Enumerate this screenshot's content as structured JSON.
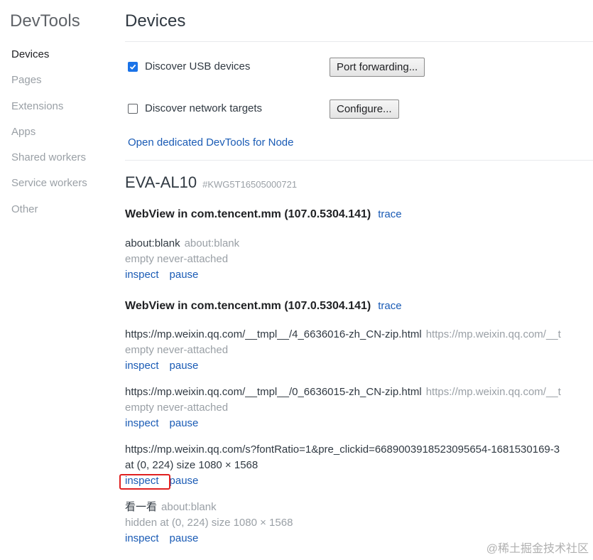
{
  "sidebar": {
    "title": "DevTools",
    "items": [
      {
        "label": "Devices",
        "selected": true
      },
      {
        "label": "Pages"
      },
      {
        "label": "Extensions"
      },
      {
        "label": "Apps"
      },
      {
        "label": "Shared workers"
      },
      {
        "label": "Service workers"
      },
      {
        "label": "Other"
      }
    ]
  },
  "main": {
    "title": "Devices",
    "discover_usb": {
      "label": "Discover USB devices",
      "checked": true,
      "button": "Port forwarding..."
    },
    "discover_network": {
      "label": "Discover network targets",
      "checked": false,
      "button": "Configure..."
    },
    "node_link": "Open dedicated DevTools for Node",
    "device": {
      "model": "EVA-AL10",
      "serial": "#KWG5T16505000721",
      "browsers": [
        {
          "name": "WebView in com.tencent.mm (107.0.5304.141)",
          "trace": "trace",
          "targets": [
            {
              "name": "about:blank",
              "url": "about:blank",
              "desc": "empty never-attached",
              "inspect": "inspect",
              "pause": "pause"
            }
          ]
        },
        {
          "name": "WebView in com.tencent.mm (107.0.5304.141)",
          "trace": "trace",
          "targets": [
            {
              "name": "https://mp.weixin.qq.com/__tmpl__/4_6636016-zh_CN-zip.html",
              "url": "https://mp.weixin.qq.com/__t",
              "desc": "empty never-attached",
              "inspect": "inspect",
              "pause": "pause"
            },
            {
              "name": "https://mp.weixin.qq.com/__tmpl__/0_6636015-zh_CN-zip.html",
              "url": "https://mp.weixin.qq.com/__t",
              "desc": "empty never-attached",
              "inspect": "inspect",
              "pause": "pause"
            },
            {
              "name": "https://mp.weixin.qq.com/s?fontRatio=1&pre_clickid=6689003918523095654-1681530169-3",
              "url": "",
              "desc": "at (0, 224)  size 1080 × 1568",
              "inspect": "inspect",
              "pause": "pause"
            },
            {
              "name": "看一看",
              "url": "about:blank",
              "desc": "hidden  at (0, 224)  size 1080 × 1568",
              "inspect": "inspect",
              "pause": "pause"
            }
          ]
        }
      ]
    }
  },
  "watermark": "@稀土掘金技术社区",
  "colors": {
    "accent": "#1a73e8",
    "link": "#1a5bb5",
    "highlight": "#e02020",
    "muted": "#9aa0a6"
  }
}
